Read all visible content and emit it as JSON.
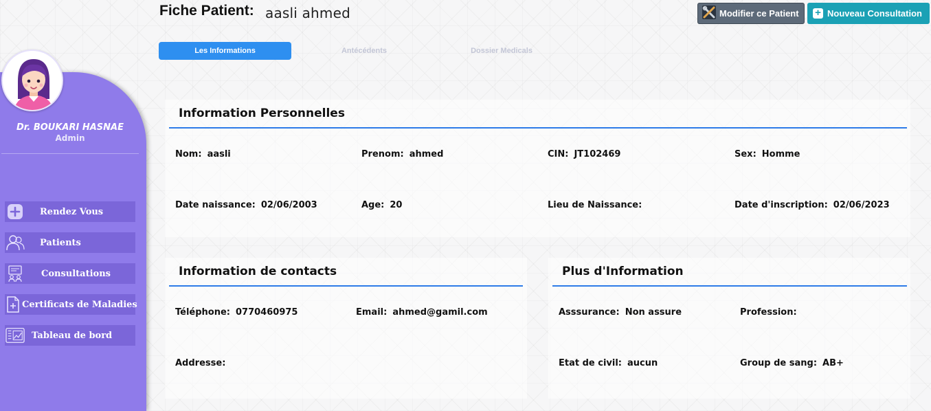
{
  "header": {
    "title": "Fiche Patient:",
    "patient_name": "aasli ahmed",
    "edit_button": "Modifier ce Patient",
    "new_button": "Nouveau Consultation"
  },
  "tabs": [
    {
      "label": "Les Informations",
      "active": true
    },
    {
      "label": "Antécédents",
      "active": false
    },
    {
      "label": "Dossier Medicals",
      "active": false
    }
  ],
  "sidebar": {
    "doctor_name": "Dr. BOUKARI HASNAE",
    "role": "Admin",
    "items": [
      {
        "label": "Rendez Vous",
        "icon": "plus-icon"
      },
      {
        "label": "Patients",
        "icon": "users-icon"
      },
      {
        "label": "Consultations",
        "icon": "consultation-icon"
      },
      {
        "label": "Certificats de Maladies",
        "icon": "document-plus-icon"
      },
      {
        "label": "Tableau de bord",
        "icon": "dashboard-icon"
      }
    ]
  },
  "personal": {
    "title": "Information Personnelles",
    "nom": {
      "label": "Nom:",
      "value": "aasli"
    },
    "prenom": {
      "label": "Prenom:",
      "value": "ahmed"
    },
    "cin": {
      "label": "CIN:",
      "value": "JT102469"
    },
    "sex": {
      "label": "Sex:",
      "value": "Homme"
    },
    "date_naissance": {
      "label": "Date naissance:",
      "value": "02/06/2003"
    },
    "age": {
      "label": "Age:",
      "value": "20"
    },
    "lieu_naissance": {
      "label": "Lieu de  Naissance:",
      "value": ""
    },
    "date_inscription": {
      "label": "Date d'inscription:",
      "value": "02/06/2023"
    }
  },
  "contacts": {
    "title": "Information de contacts",
    "telephone": {
      "label": "Téléphone:",
      "value": "0770460975"
    },
    "email": {
      "label": "Email:",
      "value": "ahmed@gamil.com"
    },
    "adresse": {
      "label": "Addresse:",
      "value": ""
    }
  },
  "plus": {
    "title": "Plus d'Information",
    "assurance": {
      "label": "Asssurance:",
      "value": "Non assure"
    },
    "profession": {
      "label": "Profession:",
      "value": ""
    },
    "etat_civil": {
      "label": "Etat de civil:",
      "value": "aucun"
    },
    "groupe_sang": {
      "label": "Group de sang:",
      "value": "AB+"
    }
  },
  "colors": {
    "sidebar": "#8f7bea",
    "nav_item": "#7b66d9",
    "active_tab": "#2e8ff0",
    "rule": "#2d7be8",
    "edit_button": "#5d6a79",
    "new_button": "#1ba1b5"
  }
}
